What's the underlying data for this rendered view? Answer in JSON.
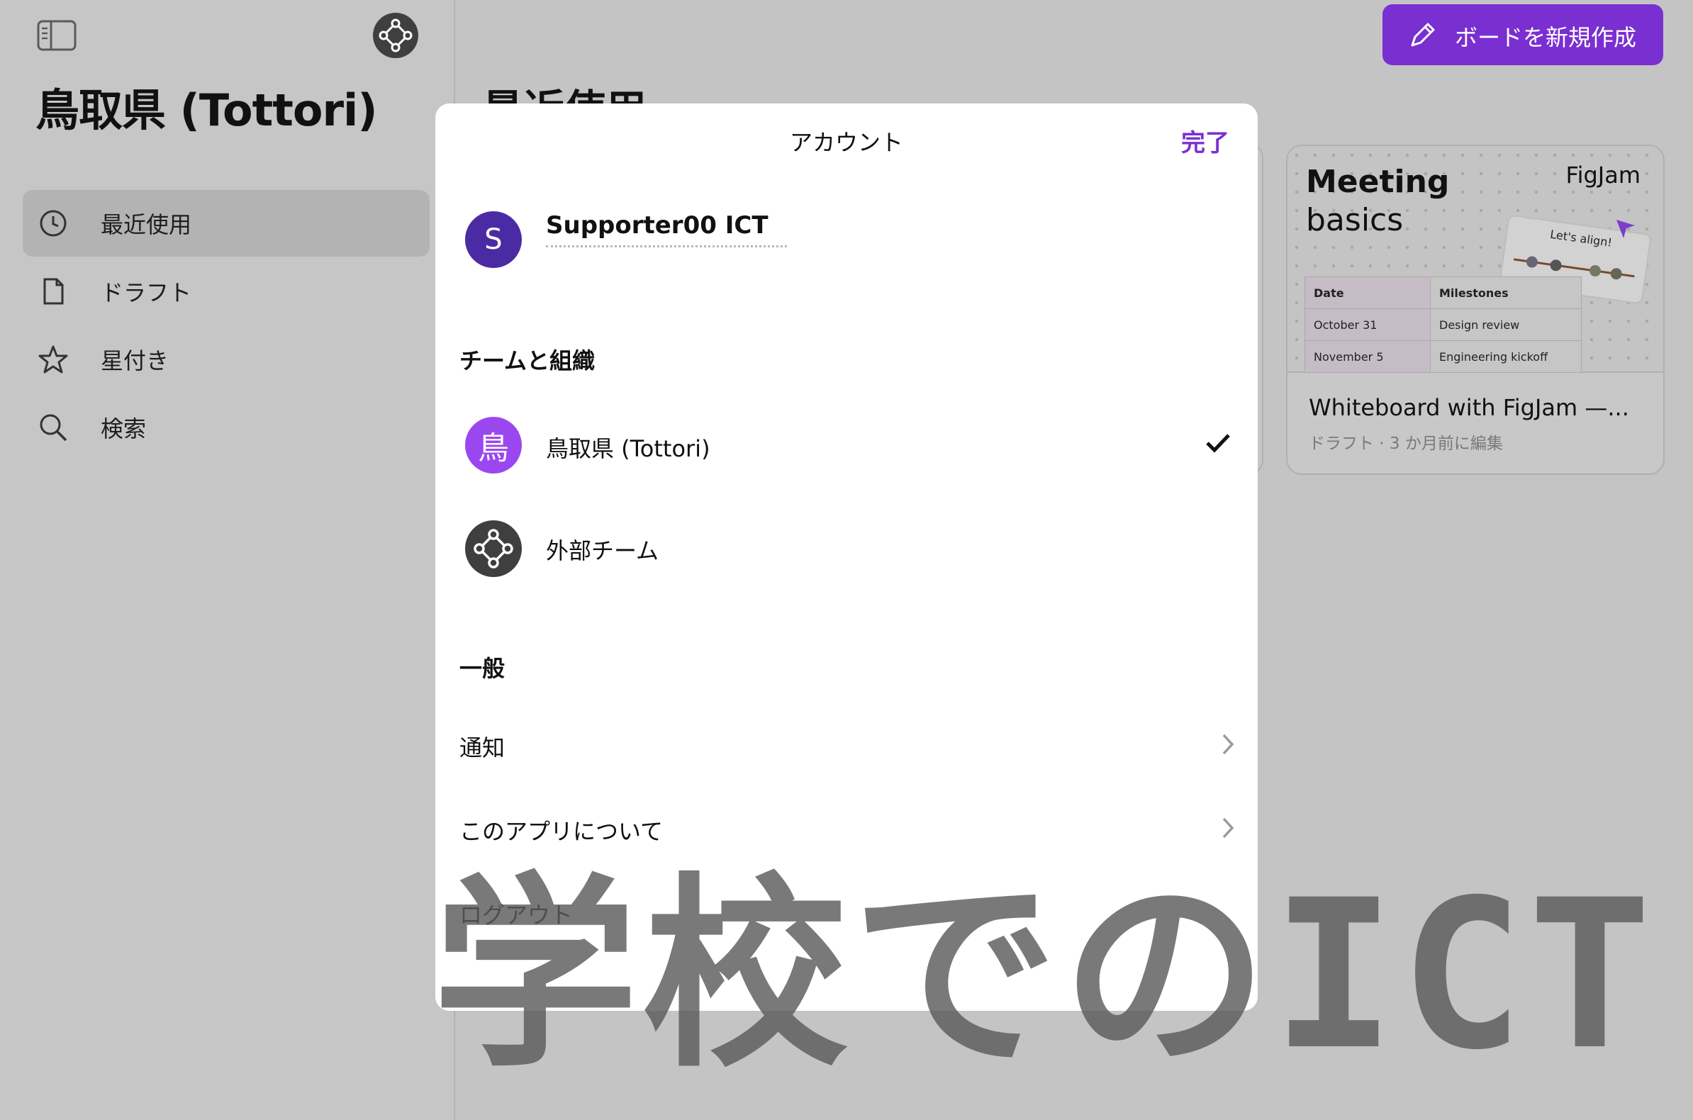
{
  "sidebar": {
    "org_name": "鳥取県 (Tottori)",
    "items": [
      {
        "label": "最近使用",
        "icon": "clock-icon",
        "active": true
      },
      {
        "label": "ドラフト",
        "icon": "document-icon",
        "active": false
      },
      {
        "label": "星付き",
        "icon": "star-icon",
        "active": false
      },
      {
        "label": "検索",
        "icon": "search-icon",
        "active": false
      }
    ]
  },
  "main": {
    "section_title": "最近使用",
    "new_board_label": "ボードを新規作成",
    "card": {
      "thumb_title_bold": "Meeting",
      "thumb_title_rest": "basics",
      "thumb_brand": "FigJam",
      "sticker_text": "Let's align!",
      "table_headers": [
        "Date",
        "Milestones"
      ],
      "table_rows": [
        [
          "October 31",
          "Design review"
        ],
        [
          "November 5",
          "Engineering kickoff"
        ]
      ],
      "name": "Whiteboard with FigJam —...",
      "meta": "ドラフト · 3 か月前に編集"
    }
  },
  "modal": {
    "title": "アカウント",
    "done_label": "完了",
    "user": {
      "initial": "S",
      "name": "Supporter00 ICT",
      "avatar_color": "#4b2ba3"
    },
    "teams_header": "チームと組織",
    "teams": [
      {
        "initial": "鳥",
        "name": "鳥取県 (Tottori)",
        "selected": true,
        "avatar_color": "#9b47f0"
      },
      {
        "initial": "",
        "name": "外部チーム",
        "selected": false,
        "avatar_color": "#3f3f3f"
      }
    ],
    "general_header": "一般",
    "general_items": [
      {
        "label": "通知"
      },
      {
        "label": "このアプリについて"
      }
    ],
    "logout_label": "ログアウト"
  },
  "watermark": "学校でのICT",
  "colors": {
    "accent": "#7a2fd1",
    "overlay_bg": "#c4c4c4"
  }
}
